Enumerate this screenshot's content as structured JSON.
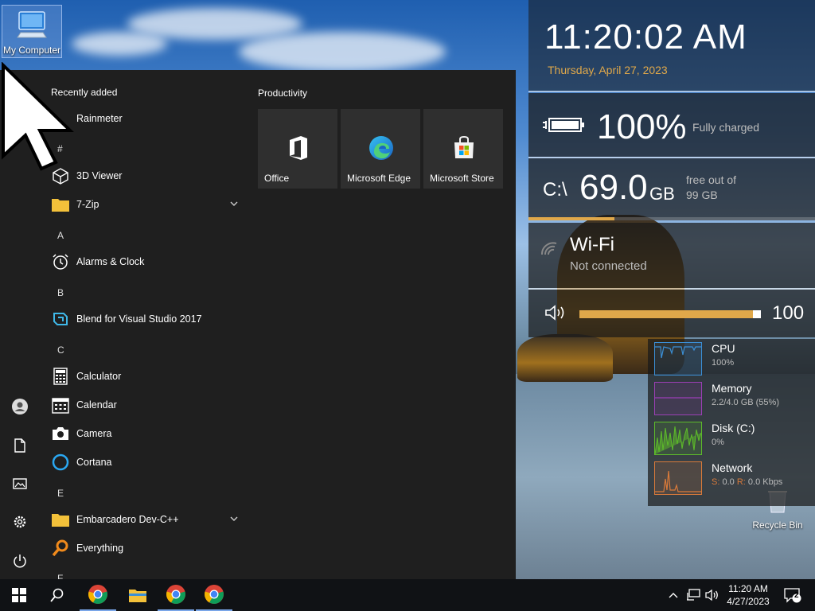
{
  "desktop": {
    "my_computer_label": "My Computer",
    "recycle_bin_label": "Recycle Bin"
  },
  "start_menu": {
    "recently_added_title": "Recently added",
    "recent_app": "Rainmeter",
    "groups": [
      {
        "letter": "#",
        "apps": [
          {
            "label": "3D Viewer",
            "icon": "cube-icon"
          },
          {
            "label": "7-Zip",
            "icon": "folder-icon",
            "expandable": true
          }
        ]
      },
      {
        "letter": "A",
        "apps": [
          {
            "label": "Alarms & Clock",
            "icon": "alarm-clock-icon"
          }
        ]
      },
      {
        "letter": "B",
        "apps": [
          {
            "label": "Blend for Visual Studio 2017",
            "icon": "blend-icon"
          }
        ]
      },
      {
        "letter": "C",
        "apps": [
          {
            "label": "Calculator",
            "icon": "calculator-icon"
          },
          {
            "label": "Calendar",
            "icon": "calendar-icon"
          },
          {
            "label": "Camera",
            "icon": "camera-icon"
          },
          {
            "label": "Cortana",
            "icon": "cortana-icon"
          }
        ]
      },
      {
        "letter": "E",
        "apps": [
          {
            "label": "Embarcadero Dev-C++",
            "icon": "folder-icon",
            "expandable": true
          },
          {
            "label": "Everything",
            "icon": "magnifier-icon"
          }
        ]
      },
      {
        "letter": "F",
        "apps": []
      }
    ],
    "tiles_title": "Productivity",
    "tiles": [
      {
        "label": "Office",
        "icon": "office-icon",
        "color": "#d83b01"
      },
      {
        "label": "Microsoft Edge",
        "icon": "edge-icon",
        "color": "#2f2f2f"
      },
      {
        "label": "Microsoft Store",
        "icon": "store-icon",
        "color": "#2f2f2f"
      }
    ],
    "rail_icons": [
      "user-icon",
      "document-icon",
      "pictures-icon",
      "settings-icon",
      "power-icon"
    ]
  },
  "widgets": {
    "clock": {
      "time": "11:20:02 AM",
      "date": "Thursday, April 27, 2023",
      "date_color": "#e0a84a"
    },
    "battery": {
      "percent": "100%",
      "status": "Fully charged",
      "level": 1.0
    },
    "disk": {
      "drive": "C:\\",
      "free": "69.0",
      "unit": "GB",
      "label_line1": "free out of",
      "label_line2": "99 GB",
      "used_fraction": 0.3
    },
    "wifi": {
      "name": "Wi-Fi",
      "status": "Not connected"
    },
    "volume": {
      "value": "100",
      "level": 1.0,
      "accent": "#e0a84a"
    },
    "monitor": [
      {
        "name": "CPU",
        "value": "100%",
        "color": "#3b8fd6",
        "icon": "cpu-graph"
      },
      {
        "name": "Memory",
        "value": "2.2/4.0 GB (55%)",
        "color": "#9b3fb5",
        "icon": "memory-graph"
      },
      {
        "name": "Disk (C:)",
        "value": "0%",
        "color": "#5dbb2a",
        "icon": "disk-graph"
      },
      {
        "name": "Network",
        "value_s_label": "S:",
        "value_s": "0.0",
        "value_r_label": "R:",
        "value_r": "0.0 Kbps",
        "color": "#d97a3a",
        "icon": "network-graph"
      }
    ]
  },
  "taskbar": {
    "time": "11:20 AM",
    "date": "4/27/2023",
    "notification_count": "2",
    "apps": [
      "windows-start-icon",
      "search-icon",
      "chrome-icon",
      "file-explorer-icon",
      "chrome-icon",
      "chrome-icon"
    ]
  }
}
